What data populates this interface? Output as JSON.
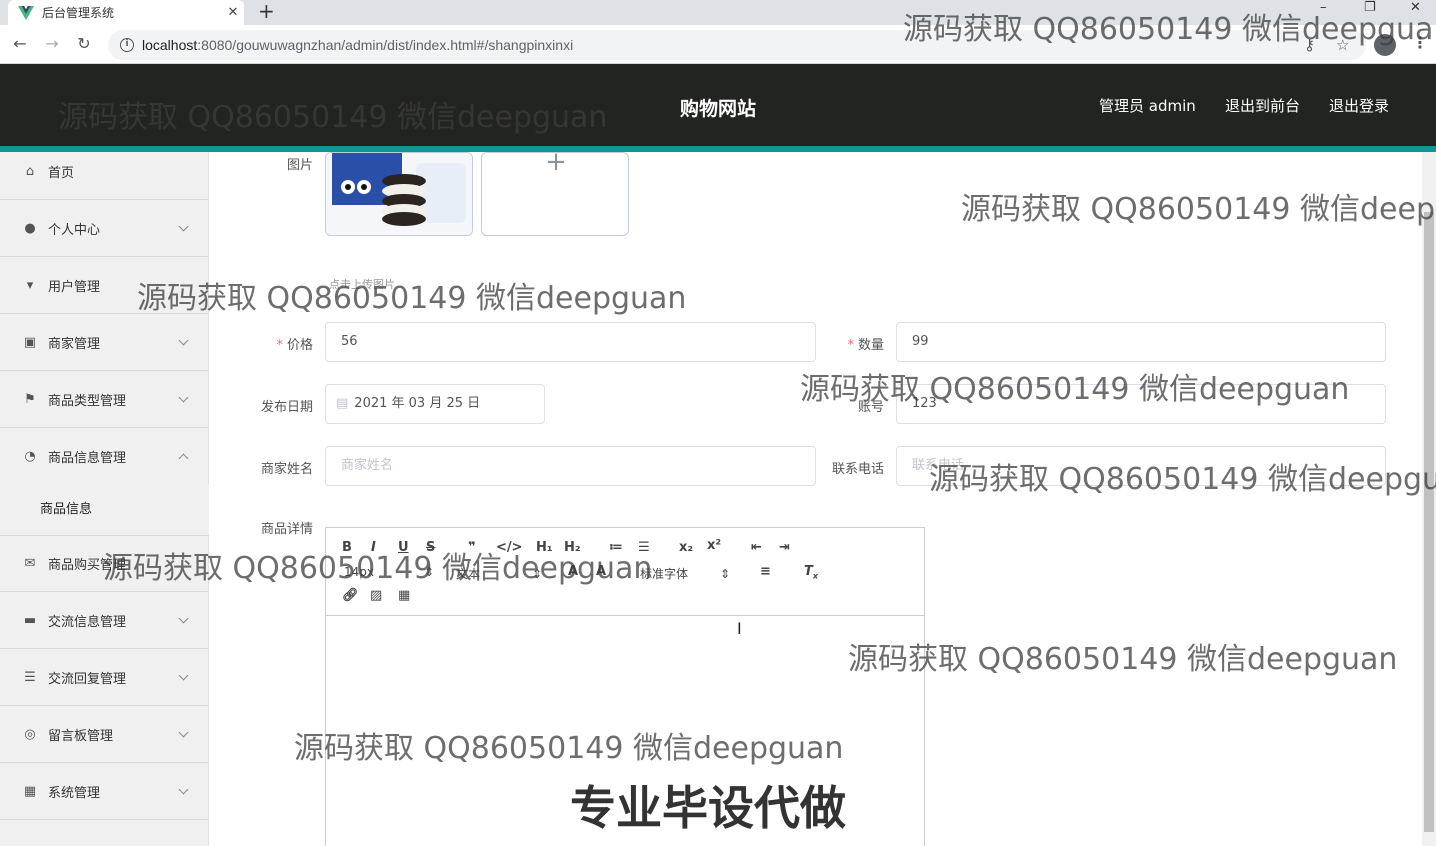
{
  "browser": {
    "tab_title": "后台管理系统",
    "url_host": "localhost",
    "url_rest": ":8080/gouwuwagnzhan/admin/dist/index.html#/shangpinxinxi"
  },
  "header": {
    "title": "购物网站",
    "admin_label": "管理员 admin",
    "to_front": "退出到前台",
    "logout": "退出登录"
  },
  "sidebar": {
    "items": [
      {
        "label": "首页"
      },
      {
        "label": "个人中心"
      },
      {
        "label": "用户管理"
      },
      {
        "label": "商家管理"
      },
      {
        "label": "商品类型管理"
      },
      {
        "label": "商品信息管理"
      },
      {
        "label": "商品购买管理"
      },
      {
        "label": "交流信息管理"
      },
      {
        "label": "交流回复管理"
      },
      {
        "label": "留言板管理"
      },
      {
        "label": "系统管理"
      }
    ],
    "sub_item": "商品信息"
  },
  "form": {
    "picture_label": "图片",
    "upload_tip": "点击上传图片",
    "price_label": "价格",
    "price_value": "56",
    "quantity_label": "数量",
    "quantity_value": "99",
    "date_label": "发布日期",
    "date_value": "2021 年 03 月 25 日",
    "account_label": "账号",
    "account_value": "123",
    "merchant_label": "商家姓名",
    "merchant_placeholder": "商家姓名",
    "phone_label": "联系电话",
    "phone_placeholder": "联系电话",
    "detail_label": "商品详情"
  },
  "editor": {
    "font_size": "14px",
    "text_type": "文本",
    "font_family": "标准字体"
  },
  "watermarks": {
    "text": "源码获取 QQ86050149 微信deepguan",
    "promo": "专业毕设代做"
  }
}
